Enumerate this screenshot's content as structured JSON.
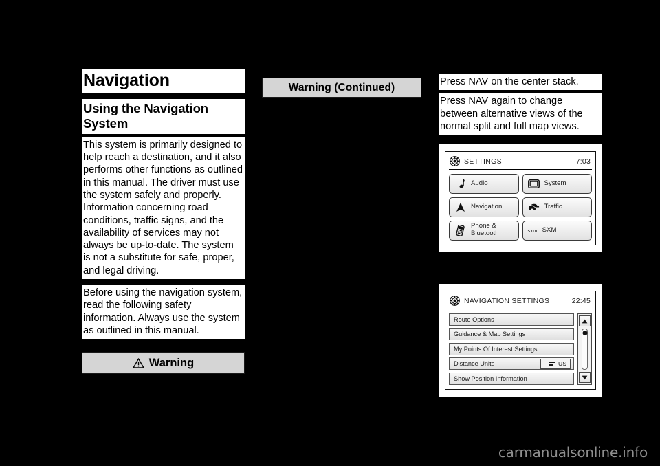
{
  "page": {
    "background_color": "#000000",
    "watermark": "carmanualsonline.info"
  },
  "left_column": {
    "chapter_title": "Navigation",
    "section_title": "Using the Navigation System",
    "paragraph_1": "This system is primarily designed to help reach a destination, and it also performs other functions as outlined in this manual. The driver must use the system safely and properly. Information concerning road conditions, traffic signs, and the availability of services may not always be up-to-date. The system is not a substitute for safe, proper, and legal driving.",
    "paragraph_2": "Before using the navigation system, read the following safety information. Always use the system as outlined in this manual.",
    "warning_label": "Warning",
    "warning_icon": "warning-triangle-icon"
  },
  "middle_column": {
    "warning_continued_label": "Warning  (Continued)"
  },
  "right_column": {
    "line_1": "Press NAV on the center stack.",
    "line_2": "Press NAV again to change between alternative views of the normal split and full map views."
  },
  "settings_screen": {
    "header_icon": "gear-icon",
    "title": "SETTINGS",
    "clock": "7:03",
    "tiles": [
      {
        "label": "Audio",
        "icon": "music-note-icon"
      },
      {
        "label": "System",
        "icon": "display-screen-icon"
      },
      {
        "label": "Navigation",
        "icon": "nav-arrow-icon"
      },
      {
        "label": "Traffic",
        "icon": "traffic-cars-icon"
      },
      {
        "label": "Phone & Bluetooth",
        "icon": "mobile-phone-icon"
      },
      {
        "label": "SXM",
        "icon": "sxm-logo-icon",
        "prefix": "sxm"
      }
    ]
  },
  "navigation_settings_screen": {
    "header_icon": "gear-icon",
    "title": "NAVIGATION SETTINGS",
    "clock": "22:45",
    "rows": [
      {
        "label": "Route Options"
      },
      {
        "label": "Guidance & Map Settings"
      },
      {
        "label": "My Points Of Interest Settings"
      },
      {
        "label": "Distance Units",
        "value": "US"
      },
      {
        "label": "Show Position Information"
      }
    ],
    "scroll_up_icon": "triangle-up-icon",
    "scroll_down_icon": "triangle-down-icon"
  }
}
